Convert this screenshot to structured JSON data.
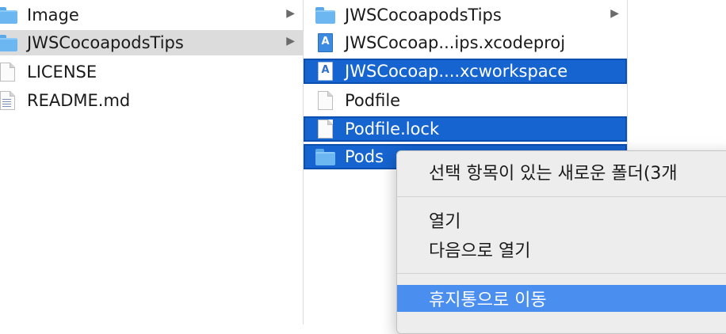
{
  "column1": {
    "items": [
      {
        "label": "Image",
        "icon": "folder-icon",
        "has_children": true
      },
      {
        "label": "JWSCocoapodsTips",
        "icon": "folder-icon",
        "has_children": true,
        "state": "highlighted"
      },
      {
        "label": "LICENSE",
        "icon": "document-icon",
        "has_children": false
      },
      {
        "label": "README.md",
        "icon": "text-document-icon",
        "has_children": false
      }
    ]
  },
  "column2": {
    "items": [
      {
        "label": "JWSCocoapodsTips",
        "icon": "folder-icon",
        "has_children": true
      },
      {
        "label": "JWSCocoap...ips.xcodeproj",
        "icon": "xcodeproj-icon",
        "has_children": false
      },
      {
        "label": "JWSCocoap....xcworkspace",
        "icon": "xcworkspace-icon",
        "has_children": false,
        "state": "selected"
      },
      {
        "label": "Podfile",
        "icon": "document-icon",
        "has_children": false
      },
      {
        "label": "Podfile.lock",
        "icon": "document-icon",
        "has_children": false,
        "state": "selected"
      },
      {
        "label": "Pods",
        "icon": "folder-icon",
        "has_children": true,
        "state": "selected"
      }
    ]
  },
  "chevron": "▶",
  "context_menu": {
    "groups": [
      [
        "선택 항목이 있는 새로운 폴더(3개"
      ],
      [
        "열기",
        "다음으로 열기"
      ],
      [
        "휴지통으로 이동"
      ]
    ],
    "selected_item": "휴지통으로 이동"
  },
  "colors": {
    "selection_blue": "#1664d0",
    "menu_highlight": "#4a8ef0",
    "folder_blue": "#6cb7f2",
    "path_gray": "#dcdcdc"
  }
}
